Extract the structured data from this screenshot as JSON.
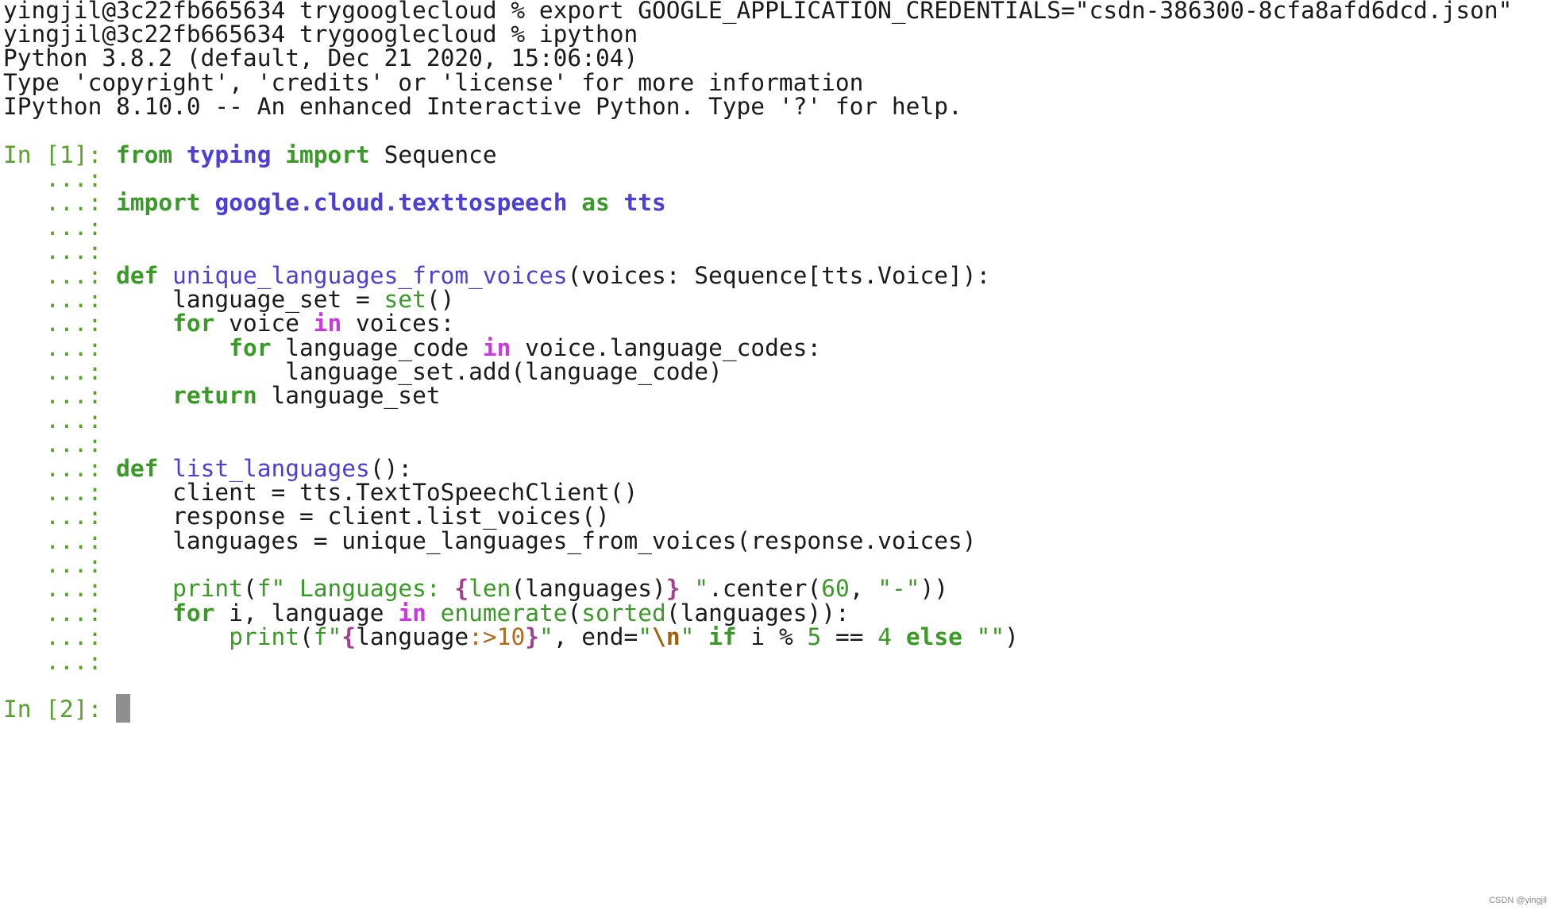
{
  "terminal": {
    "header_lines": [
      "yingjil@3c22fb665634 trygooglecloud % export GOOGLE_APPLICATION_CREDENTIALS=\"csdn-386300-8cfa8afd6dcd.json\"",
      "yingjil@3c22fb665634 trygooglecloud % ipython",
      "Python 3.8.2 (default, Dec 21 2020, 15:06:04)",
      "Type 'copyright', 'credits' or 'license' for more information",
      "IPython 8.10.0 -- An enhanced Interactive Python. Type '?' for help."
    ],
    "prompt_in1": "In [1]: ",
    "prompt_cont": "   ...: ",
    "prompt_in2": "In [2]: ",
    "tokens": {
      "from": "from",
      "typing": "typing",
      "import": "import",
      "Sequence": " Sequence",
      "import2": "import",
      "gct": "google.cloud.texttospeech",
      "as": "as",
      "tts": "tts",
      "def1": "def",
      "fn1": "unique_languages_from_voices",
      "fn1_sig": "(voices: Sequence[tts.Voice]):",
      "ls_assign": "    language_set = ",
      "set": "set",
      "paren": "()",
      "for1": "    for",
      "voice_var": " voice ",
      "in1": "in",
      "voices_colon": " voices:",
      "for2": "        for",
      "lc_var": " language_code ",
      "in2": "in",
      "vlc": " voice.language_codes:",
      "add_line": "            language_set.add(language_code)",
      "return": "    return",
      "ret_val": " language_set",
      "def2": "def",
      "fn2": "list_languages",
      "fn2_sig": "():",
      "client_line": "    client = tts.TextToSpeechClient()",
      "response_line": "    response = client.list_voices()",
      "languages_line": "    languages = unique_languages_from_voices(response.voices)",
      "print1": "print",
      "p1_open": "(",
      "p1_f": "f\"",
      "p1_text": " Languages: ",
      "p1_lb": "{",
      "p1_len": "len",
      "p1_arg": "(languages)",
      "p1_rb": "}",
      "p1_q": " \"",
      "p1_center": ".center(",
      "p1_60": "60",
      "p1_comma": ", ",
      "p1_dash": "\"-\"",
      "p1_close": "))",
      "for3": "for",
      "for3_mid": " i, language ",
      "in3": "in",
      "enumerate": "enumerate",
      "p_open": "(",
      "sorted": "sorted",
      "sorted_arg": "(languages)):",
      "print2": "print",
      "p2_open": "(",
      "p2_f": "f\"",
      "p2_lb": "{",
      "p2_lang": "language",
      "p2_spec": ":>10",
      "p2_rb": "}",
      "p2_q": "\"",
      "p2_end": ", end=",
      "p2_q1": "\"",
      "p2_nl": "\\n",
      "p2_q2": "\"",
      "if": "if",
      "p2_cond": " i % ",
      "n5": "5",
      "p2_eq": " == ",
      "n4": "4",
      "else": "else",
      "p2_empty": "\"\"",
      "p2_close": ")"
    }
  },
  "watermark": "CSDN @yingjil"
}
